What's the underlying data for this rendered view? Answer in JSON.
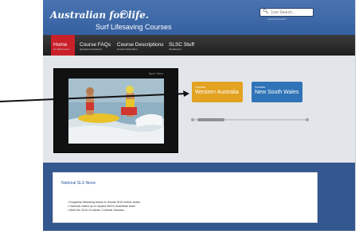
{
  "header": {
    "logo_text": "Australian for life.",
    "logo_badge": "☺",
    "site_title": "Surf Lifesaving Courses",
    "search": {
      "placeholder": "Live Search...",
      "sub_text": "Advanced Search"
    }
  },
  "nav": {
    "items": [
      {
        "label": "Home",
        "sub": "Go Back Home"
      },
      {
        "label": "Course FAQs",
        "sub": "Questions Answered"
      },
      {
        "label": "Course Descriptions",
        "sub": "Course Information"
      },
      {
        "label": "SLSC Stuff",
        "sub": "All about us"
      }
    ]
  },
  "video": {
    "label": "Open Video"
  },
  "regions": [
    {
      "pre": "Courses",
      "name": "Western Australia",
      "color": "#e3a220"
    },
    {
      "pre": "Courses",
      "name": "New South Wales",
      "color": "#2f73b8"
    }
  ],
  "news": {
    "title": "National SLS News",
    "items": [
      "Drogheda lifesaving teams to reunite SHO before active",
      "Hancock called up to replace Bell in Australian team",
      "Meet the 2010 Gr Adrian Curlewis Scholars"
    ]
  },
  "colors": {
    "header_blue": "#3a64a0",
    "nav_active_red": "#c9202a",
    "wa_orange": "#e3a220",
    "nsw_blue": "#2f73b8",
    "lower_band_blue": "#34578f"
  }
}
